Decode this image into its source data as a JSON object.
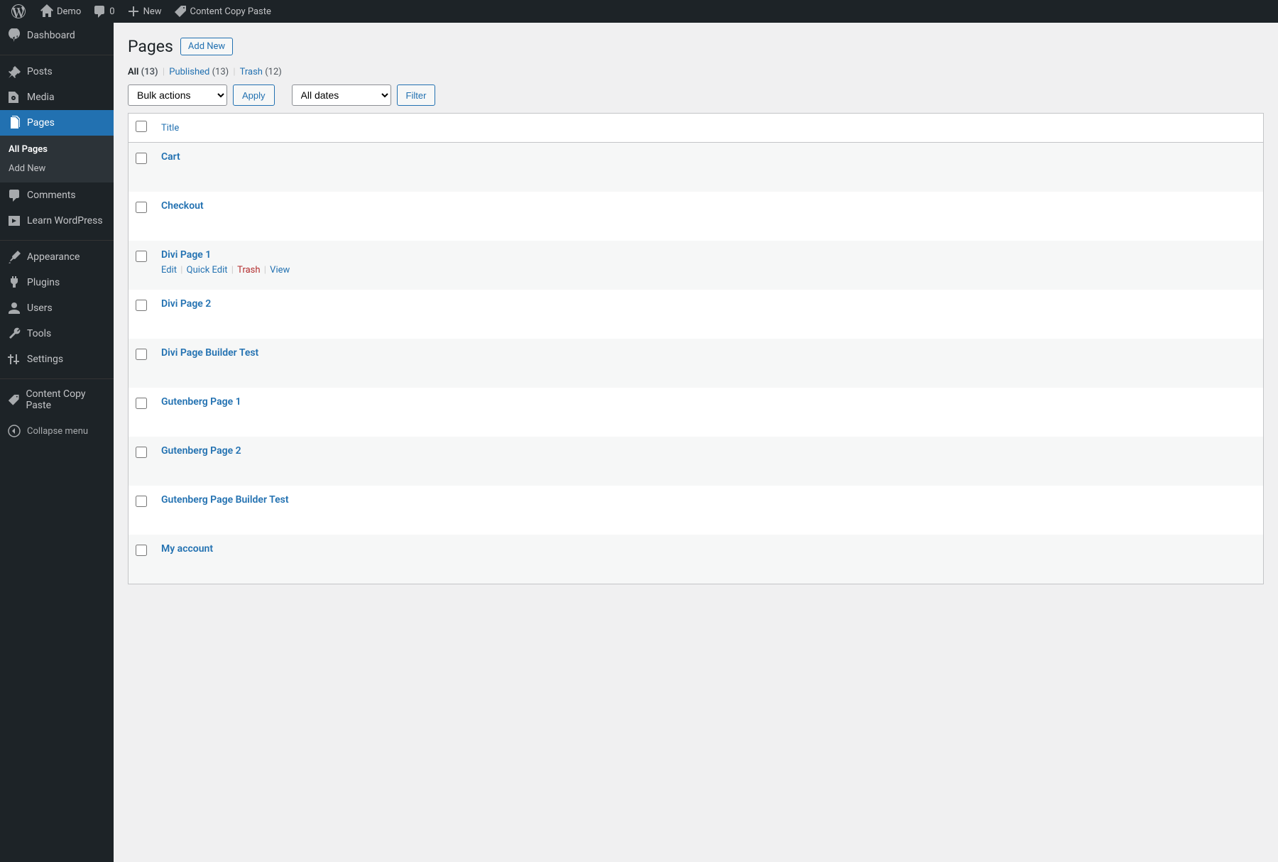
{
  "adminbar": {
    "site_name": "Demo",
    "comments_count": "0",
    "new_label": "New",
    "plugin_label": "Content Copy Paste"
  },
  "sidebar": {
    "items": [
      {
        "label": "Dashboard"
      },
      {
        "label": "Posts"
      },
      {
        "label": "Media"
      },
      {
        "label": "Pages"
      },
      {
        "label": "Comments"
      },
      {
        "label": "Learn WordPress"
      },
      {
        "label": "Appearance"
      },
      {
        "label": "Plugins"
      },
      {
        "label": "Users"
      },
      {
        "label": "Tools"
      },
      {
        "label": "Settings"
      },
      {
        "label": "Content Copy Paste"
      }
    ],
    "submenu": [
      {
        "label": "All Pages"
      },
      {
        "label": "Add New"
      }
    ],
    "collapse_label": "Collapse menu"
  },
  "main": {
    "title": "Pages",
    "add_new": "Add New",
    "filters": {
      "all_label": "All",
      "all_count": "(13)",
      "published_label": "Published",
      "published_count": "(13)",
      "trash_label": "Trash",
      "trash_count": "(12)"
    },
    "bulk_actions_label": "Bulk actions",
    "apply_label": "Apply",
    "all_dates_label": "All dates",
    "filter_label": "Filter",
    "column_title": "Title",
    "row_actions": {
      "edit": "Edit",
      "quick_edit": "Quick Edit",
      "trash": "Trash",
      "view": "View"
    },
    "pages": [
      {
        "title": "Cart"
      },
      {
        "title": "Checkout"
      },
      {
        "title": "Divi Page 1",
        "show_actions": true
      },
      {
        "title": "Divi Page 2"
      },
      {
        "title": "Divi Page Builder Test"
      },
      {
        "title": "Gutenberg Page 1"
      },
      {
        "title": "Gutenberg Page 2"
      },
      {
        "title": "Gutenberg Page Builder Test"
      },
      {
        "title": "My account"
      }
    ]
  }
}
